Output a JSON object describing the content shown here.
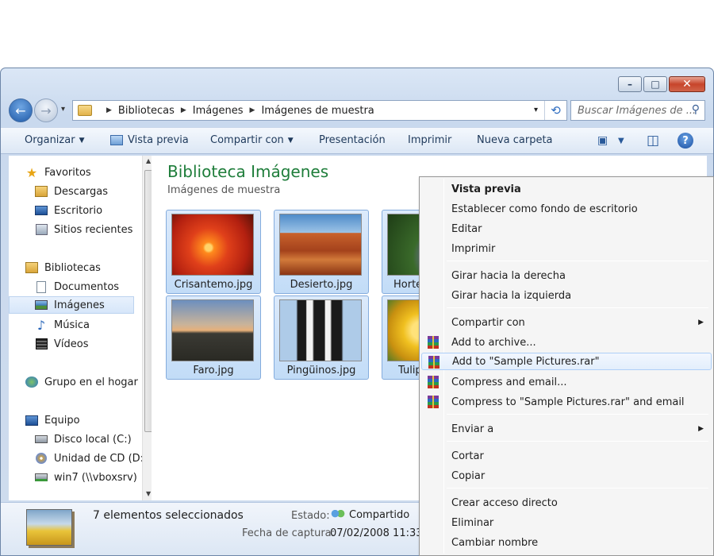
{
  "window": {
    "caption_buttons": {
      "minimize": "–",
      "maximize": "□",
      "close": "✕"
    }
  },
  "nav": {
    "back_icon": "←",
    "forward_icon": "→",
    "dropdown_icon": "▾",
    "breadcrumb": [
      "Bibliotecas",
      "Imágenes",
      "Imágenes de muestra"
    ],
    "breadcrumb_sep": "▶",
    "refresh_icon": "⟲",
    "search_placeholder": "Buscar Imágenes de ...",
    "search_icon": "⚲"
  },
  "toolbar": {
    "organize": "Organizar",
    "preview": "Vista previa",
    "share": "Compartir con",
    "slideshow": "Presentación",
    "print": "Imprimir",
    "new_folder": "Nueva carpeta",
    "dropdown_arrow": "▼",
    "view_icon": "▣",
    "pane_icon": "◫",
    "help": "?"
  },
  "sidebar": {
    "favorites": "Favoritos",
    "downloads": "Descargas",
    "desktop": "Escritorio",
    "recent": "Sitios recientes",
    "libraries": "Bibliotecas",
    "documents": "Documentos",
    "pictures": "Imágenes",
    "music": "Música",
    "videos": "Vídeos",
    "homegroup": "Grupo en el hogar",
    "computer": "Equipo",
    "local_disk": "Disco local (C:)",
    "cd_drive": "Unidad de CD (D:",
    "network": "win7 (\\\\vboxsrv)",
    "icons": {
      "star": "★",
      "music": "♪",
      "scroll_up": "▲",
      "scroll_down": "▼"
    }
  },
  "library": {
    "title": "Biblioteca Imágenes",
    "subtitle": "Imágenes de muestra",
    "files": [
      "Crisantemo.jpg",
      "Desierto.jpg",
      "Horte",
      "Faro.jpg",
      "Pingüinos.jpg",
      "Tulip"
    ]
  },
  "status": {
    "selected": "7 elementos seleccionados",
    "state_label": "Estado:",
    "state_value": "Compartido",
    "date_label": "Fecha de captura:",
    "date_value": "07/02/2008 11:33 -"
  },
  "context_menu": {
    "preview": "Vista previa",
    "set_background": "Establecer como fondo de escritorio",
    "edit": "Editar",
    "print": "Imprimir",
    "rotate_right": "Girar hacia la derecha",
    "rotate_left": "Girar hacia la izquierda",
    "share_with": "Compartir con",
    "add_archive": "Add to archive...",
    "add_rar": "Add to \"Sample Pictures.rar\"",
    "compress_email": "Compress and email...",
    "compress_rar_email": "Compress to \"Sample Pictures.rar\" and email",
    "send_to": "Enviar a",
    "cut": "Cortar",
    "copy": "Copiar",
    "create_shortcut": "Crear acceso directo",
    "delete": "Eliminar",
    "rename": "Cambiar nombre",
    "submenu_arrow": "▶"
  }
}
